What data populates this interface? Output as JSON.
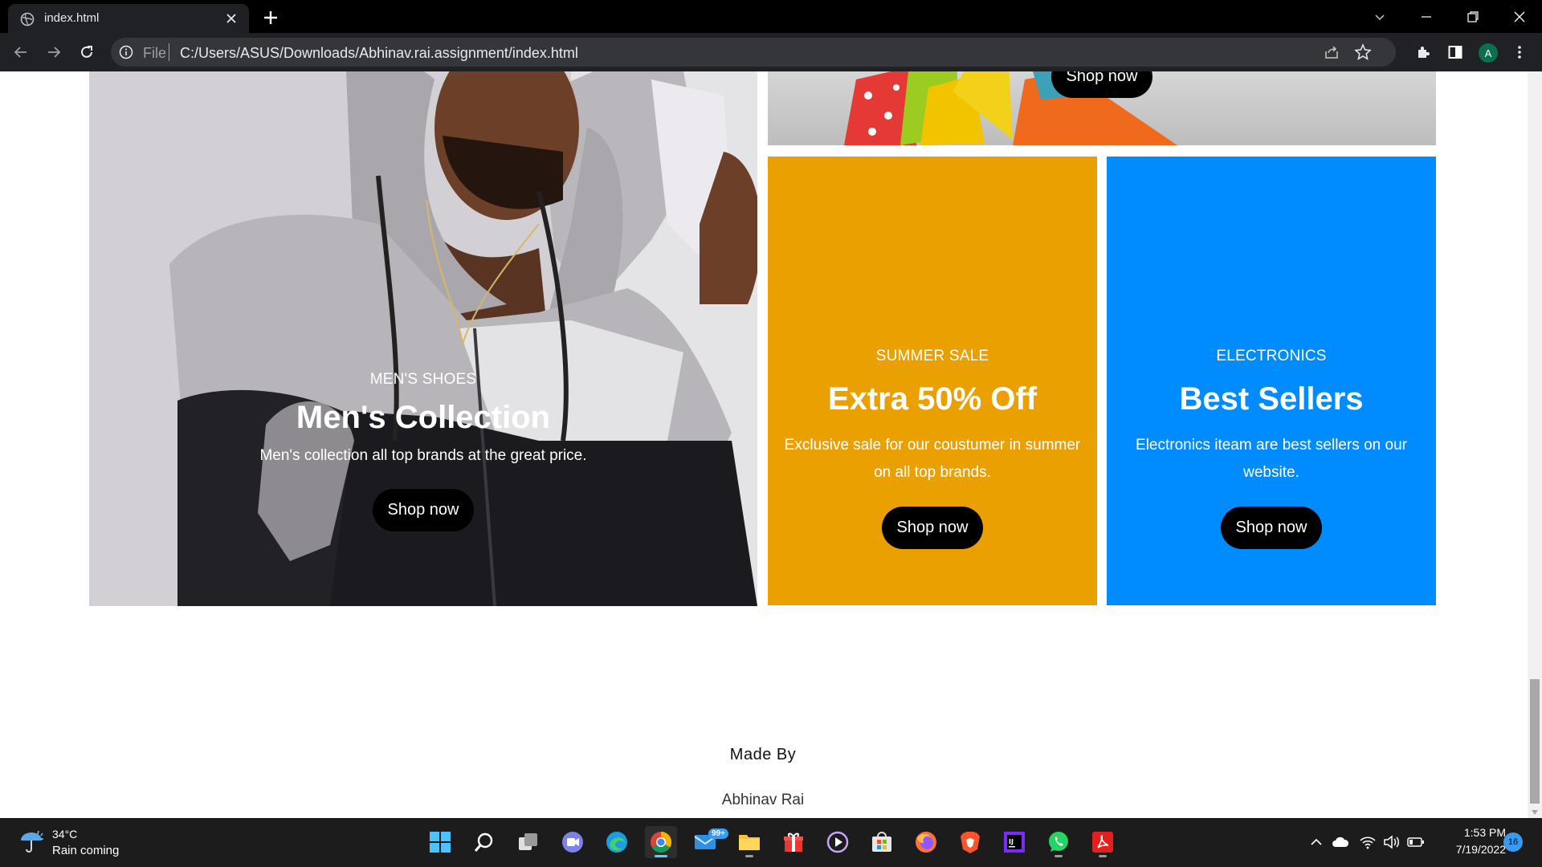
{
  "browser": {
    "tab_title": "index.html",
    "url_scheme": "File",
    "url": "C:/Users/ASUS/Downloads/Abhinav.rai.assignment/index.html",
    "profile_initial": "A"
  },
  "page": {
    "top_banner": {
      "button_label": "Shop now"
    },
    "mens_banner": {
      "subtitle": "MEN'S SHOES",
      "headline": "Men's Collection",
      "description": "Men's collection all top brands at the great price.",
      "button_label": "Shop now"
    },
    "sale_banner": {
      "subtitle": "SUMMER SALE",
      "headline": "Extra 50% Off",
      "description": "Exclusive sale for our coustumer in summer on all top brands.",
      "button_label": "Shop now",
      "color": "#e9a000"
    },
    "electronics_banner": {
      "subtitle": "ELECTRONICS",
      "headline": "Best Sellers",
      "description": "Electronics iteam are best sellers on our website.",
      "button_label": "Shop now",
      "color": "#008cff"
    },
    "footer": {
      "heading": "Made By",
      "name": "Abhinav Rai"
    }
  },
  "taskbar": {
    "weather": {
      "temp": "34°C",
      "condition": "Rain coming"
    },
    "mail_badge": "99+",
    "clock": {
      "time": "1:53 PM",
      "date": "7/19/2022"
    },
    "notification_count": "16"
  }
}
